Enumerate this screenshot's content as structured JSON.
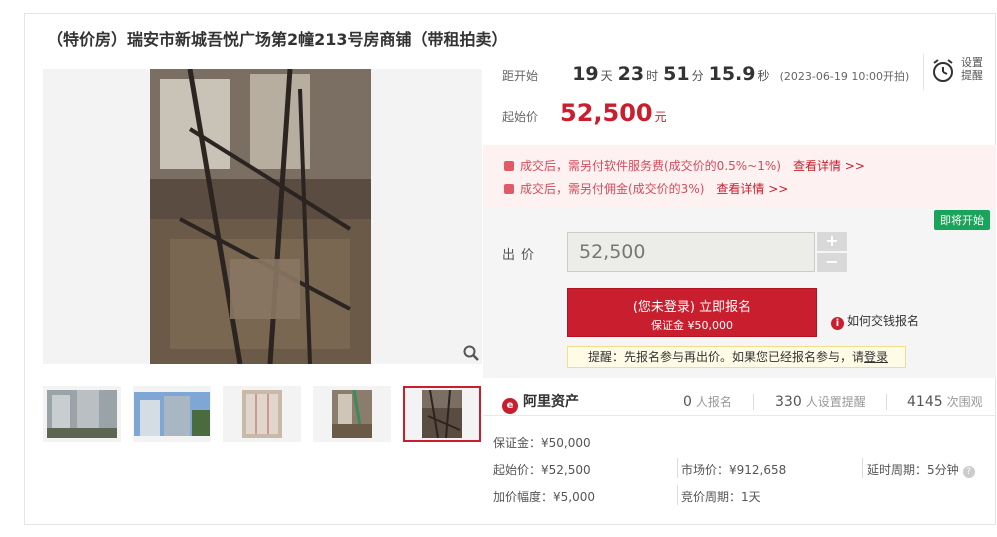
{
  "title": "（特价房）瑞安市新城吾悦广场第2幢213号房商铺（带租拍卖）",
  "countdown": {
    "label": "距开始",
    "days": "19",
    "days_unit": "天",
    "hours": "23",
    "hours_unit": "时",
    "minutes": "51",
    "minutes_unit": "分",
    "seconds": "15.9",
    "seconds_unit": "秒",
    "start_text": "(2023-06-19 10:00开拍)"
  },
  "remind": {
    "line1": "设置",
    "line2": "提醒",
    "icon": "alarm-clock-icon"
  },
  "start_price": {
    "label": "起始价",
    "value": "52,500",
    "unit": "元"
  },
  "notices": [
    {
      "text": "成交后，需另付软件服务费(成交价的0.5%~1%)",
      "link": "查看详情 >>"
    },
    {
      "text": "成交后，需另付佣金(成交价的3%)",
      "link": "查看详情 >>"
    }
  ],
  "bid": {
    "status_tag": "即将开始",
    "label": "出价",
    "value": "52,500",
    "plus": "+",
    "minus": "−",
    "button_line1": "(您未登录) 立即报名",
    "button_line2": "保证金 ¥50,000",
    "howto": "如何交钱报名",
    "tip_prefix": "提醒：先报名参与再出价。如果您已经报名参与，请",
    "tip_link": "登录"
  },
  "stats": {
    "logo": "阿里资产",
    "signups": "0",
    "signups_unit": "人报名",
    "reminders": "330",
    "reminders_unit": "人设置提醒",
    "views": "4145",
    "views_unit": "次围观"
  },
  "info": {
    "deposit": "保证金：¥50,000",
    "start_price": "起始价：¥52,500",
    "market_price": "市场价：¥912,658",
    "delay_period": "延时周期：5分钟",
    "increment": "加价幅度：¥5,000",
    "bid_period": "竞价周期：1天"
  },
  "colors": {
    "accent": "#c81e2d",
    "notice_bg": "#fdf1f1",
    "tag_green": "#1aa35a"
  }
}
